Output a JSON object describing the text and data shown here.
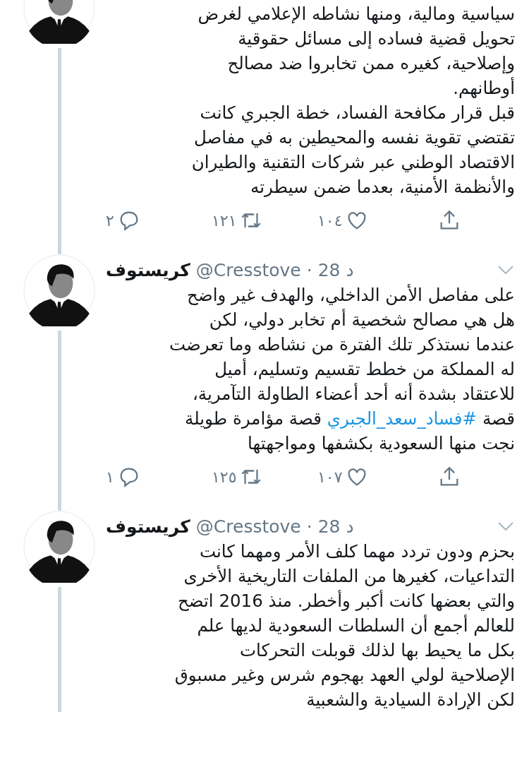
{
  "tweets": [
    {
      "segments": [
        {
          "kind": "text",
          "text": "سياسية ومالية، ومنها نشاطه الإعلامي لغرض\nتحويل قضية فساده إلى مسائل حقوقية\nوإصلاحية، كغيره ممن تخابروا ضد مصالح\nأوطانهم.\nقبل قرار مكافحة الفساد، خطة الجبري كانت\nتقتضي تقوية نفسه والمحيطين به في مفاصل\nالاقتصاد الوطني عبر شركات التقنية والطيران\nوالأنظمة الأمنية، بعدما ضمن سيطرته"
        }
      ],
      "replies": "٢",
      "retweets": "١٢١",
      "likes": "١٠٤"
    },
    {
      "name": "كريستوف",
      "handle": "@Cresstove",
      "separator": "·",
      "time": "28 د",
      "segments": [
        {
          "kind": "text",
          "text": "على مفاصل الأمن الداخلي، والهدف غير واضح\nهل هي مصالح شخصية أم تخابر دولي، لكن\nعندما نستذكر تلك الفترة من نشاطه وما تعرضت\nله المملكة من خطط تقسيم وتسليم، أميل\nللاعتقاد بشدة أنه أحد أعضاء الطاولة التآمرية،\nقصة "
        },
        {
          "kind": "hashtag",
          "text": "#فساد_سعد_الجبري"
        },
        {
          "kind": "text",
          "text": " قصة مؤامرة طويلة\nنجت منها السعودية بكشفها ومواجهتها"
        }
      ],
      "replies": "١",
      "retweets": "١٢٥",
      "likes": "١٠٧"
    },
    {
      "name": "كريستوف",
      "handle": "@Cresstove",
      "separator": "·",
      "time": "28 د",
      "segments": [
        {
          "kind": "text",
          "text": "بحزم ودون تردد مهما كلف الأمر ومهما كانت\nالتداعيات، كغيرها من الملفات التاريخية الأخرى\nوالتي بعضها كانت أكبر وأخطر. منذ 2016 اتضح\nللعالم أجمع أن السلطات السعودية لديها علم\nبكل ما يحيط بها لذلك قوبلت التحركات\nالإصلاحية لولي العهد بهجوم شرس وغير مسبوق\nلكن الإرادة السيادية والشعبية"
        }
      ]
    }
  ]
}
